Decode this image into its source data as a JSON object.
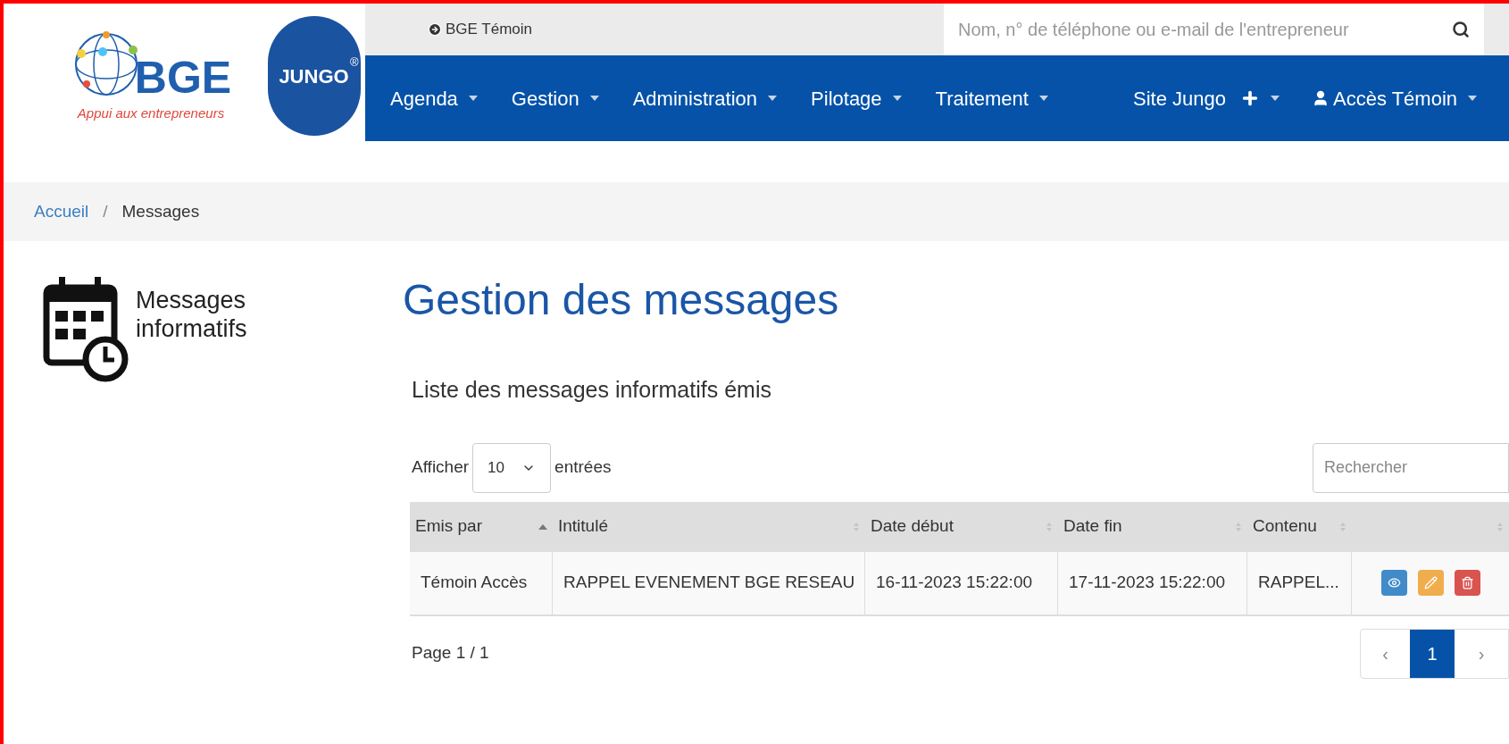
{
  "logo": {
    "name": "BGE",
    "tagline": "Appui aux entrepreneurs"
  },
  "jungo_logo": {
    "name": "JUNGO",
    "mark": "®"
  },
  "top_bar": {
    "link": "BGE Témoin",
    "search": {
      "placeholder": "Nom, n° de téléphone ou e-mail de l'entrepreneur"
    }
  },
  "nav": {
    "items": [
      {
        "label": "Agenda",
        "kind": "menu"
      },
      {
        "label": "Gestion",
        "kind": "menu"
      },
      {
        "label": "Administration",
        "kind": "menu"
      },
      {
        "label": "Pilotage",
        "kind": "menu"
      },
      {
        "label": "Traitement",
        "kind": "menu"
      }
    ],
    "right_items": [
      {
        "label": "Site Jungo",
        "kind": "plus"
      },
      {
        "label": "Accès Témoin",
        "kind": "user"
      }
    ]
  },
  "breadcrumb": [
    {
      "label": "Accueil",
      "selected": false
    },
    {
      "label": "Messages",
      "selected": true,
      "separator": "/"
    }
  ],
  "sidebar": {
    "title": "Messages informatifs"
  },
  "main": {
    "title": "Gestion des messages",
    "subtitle": "Liste des messages informatifs émis",
    "length": {
      "before": "Afficher",
      "value": "10",
      "after": "entrées"
    },
    "search": {
      "placeholder": "Rechercher"
    },
    "table": {
      "columns": [
        {
          "label": "Emis par",
          "sorted": true
        },
        {
          "label": "Intitulé",
          "sorted": false
        },
        {
          "label": "Date début",
          "sorted": false
        },
        {
          "label": "Date fin",
          "sorted": false
        },
        {
          "label": "Contenu",
          "sorted": false
        },
        {
          "sorted": false
        }
      ],
      "rows": [
        {
          "cells": [
            "Témoin Accès",
            "RAPPEL EVENEMENT BGE RESEAU",
            "16-11-2023 15:22:00",
            "17-11-2023 15:22:00",
            "RAPPEL..."
          ],
          "actions": [
            {
              "kind": "view"
            },
            {
              "kind": "edit"
            },
            {
              "kind": "delete"
            }
          ]
        }
      ]
    },
    "page_info": "Page 1 / 1",
    "pagination": {
      "prev": "‹",
      "pages": [
        {
          "label": "1",
          "selected": true
        }
      ],
      "next": "›"
    }
  }
}
